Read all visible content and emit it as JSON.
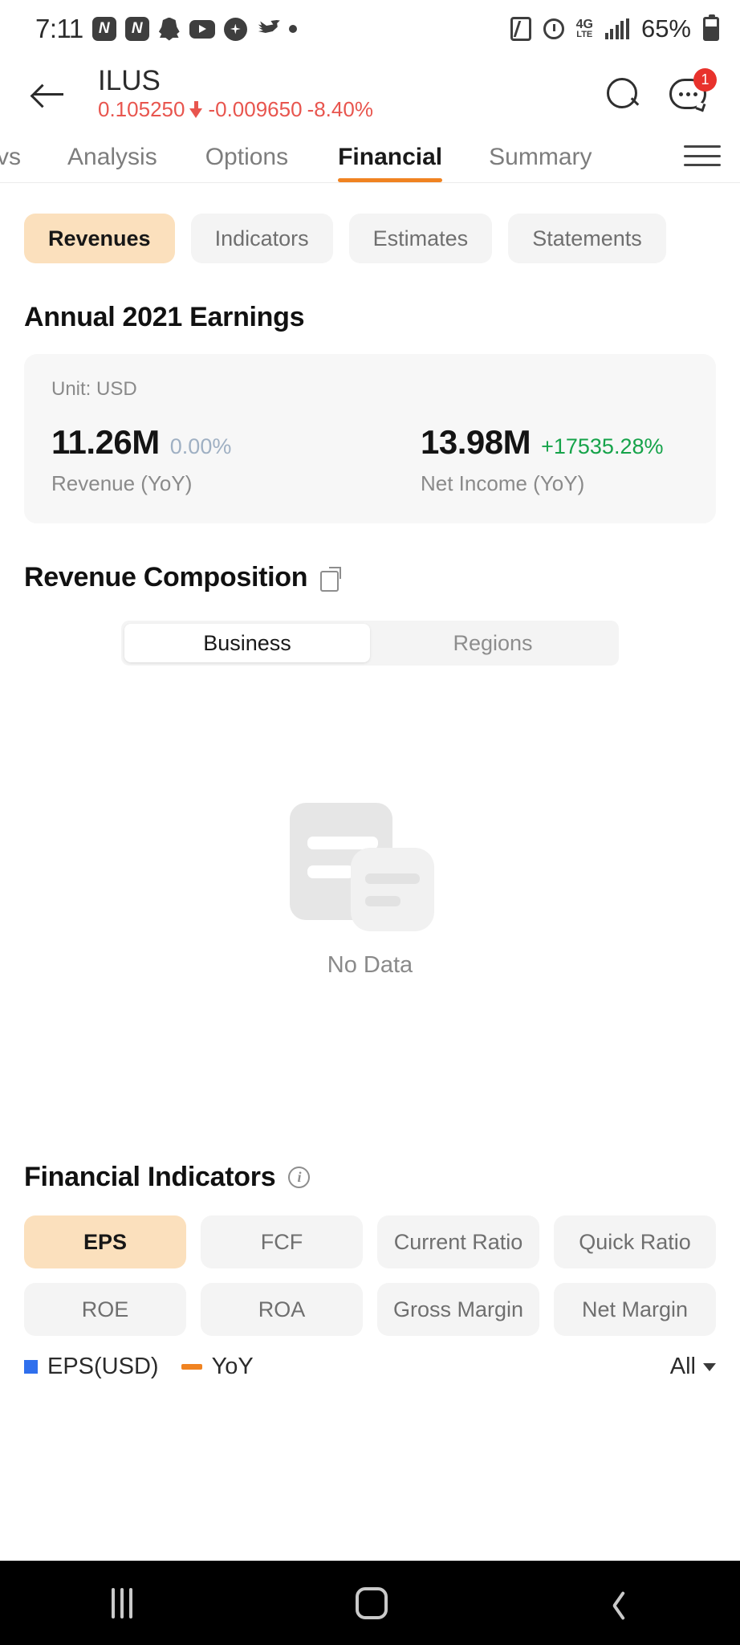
{
  "status_bar": {
    "time": "7:11",
    "left_icons": [
      "news-app-icon",
      "news-app-icon-2",
      "snapchat-icon",
      "youtube-icon",
      "compass-icon",
      "twitter-icon",
      "dot-icon"
    ],
    "nfc_label": "N",
    "network_main": "4G",
    "network_sub": "LTE",
    "battery_percent": "65%"
  },
  "header": {
    "ticker": "ILUS",
    "price": "0.105250",
    "change": "-0.009650",
    "change_percent": "-8.40%",
    "direction": "down",
    "negative_color": "#e8554e",
    "notification_count": "1"
  },
  "main_tabs": {
    "items": [
      {
        "label": "vs",
        "active": false
      },
      {
        "label": "Analysis",
        "active": false
      },
      {
        "label": "Options",
        "active": false
      },
      {
        "label": "Financial",
        "active": true
      },
      {
        "label": "Summary",
        "active": false
      }
    ],
    "active_underline_color": "#f08321",
    "menu_icon": "hamburger-menu-icon"
  },
  "sub_tabs": {
    "items": [
      {
        "label": "Revenues",
        "selected": true
      },
      {
        "label": "Indicators",
        "selected": false
      },
      {
        "label": "Estimates",
        "selected": false
      },
      {
        "label": "Statements",
        "selected": false
      }
    ],
    "selected_bg": "#fbe0bd"
  },
  "earnings": {
    "title": "Annual 2021 Earnings",
    "unit": "Unit: USD",
    "metrics": [
      {
        "value": "11.26M",
        "change": "0.00%",
        "label": "Revenue (YoY)",
        "tone": "flat"
      },
      {
        "value": "13.98M",
        "change": "+17535.28%",
        "label": "Net Income (YoY)",
        "tone": "up"
      }
    ],
    "up_color": "#16a34a",
    "flat_color": "#9fb0c3"
  },
  "revenue_composition": {
    "title": "Revenue Composition",
    "share_icon": "share-export-icon",
    "segments": [
      {
        "label": "Business",
        "active": true
      },
      {
        "label": "Regions",
        "active": false
      }
    ],
    "empty_state": {
      "icon": "no-data-document-icon",
      "text": "No Data"
    }
  },
  "financial_indicators": {
    "title": "Financial Indicators",
    "info_icon": "info-icon",
    "chips": [
      {
        "label": "EPS",
        "selected": true
      },
      {
        "label": "FCF",
        "selected": false
      },
      {
        "label": "Current Ratio",
        "selected": false
      },
      {
        "label": "Quick Ratio",
        "selected": false
      },
      {
        "label": "ROE",
        "selected": false
      },
      {
        "label": "ROA",
        "selected": false
      },
      {
        "label": "Gross Margin",
        "selected": false
      },
      {
        "label": "Net Margin",
        "selected": false
      }
    ],
    "legend": [
      {
        "label": "EPS(USD)",
        "swatch": "square",
        "color": "#2f6fed"
      },
      {
        "label": "YoY",
        "swatch": "line",
        "color": "#f08321"
      }
    ],
    "range_selector": "All"
  },
  "nav_bar": {
    "recent_label": "recent-apps-icon",
    "home_label": "home-icon",
    "back_label": "back-icon"
  }
}
